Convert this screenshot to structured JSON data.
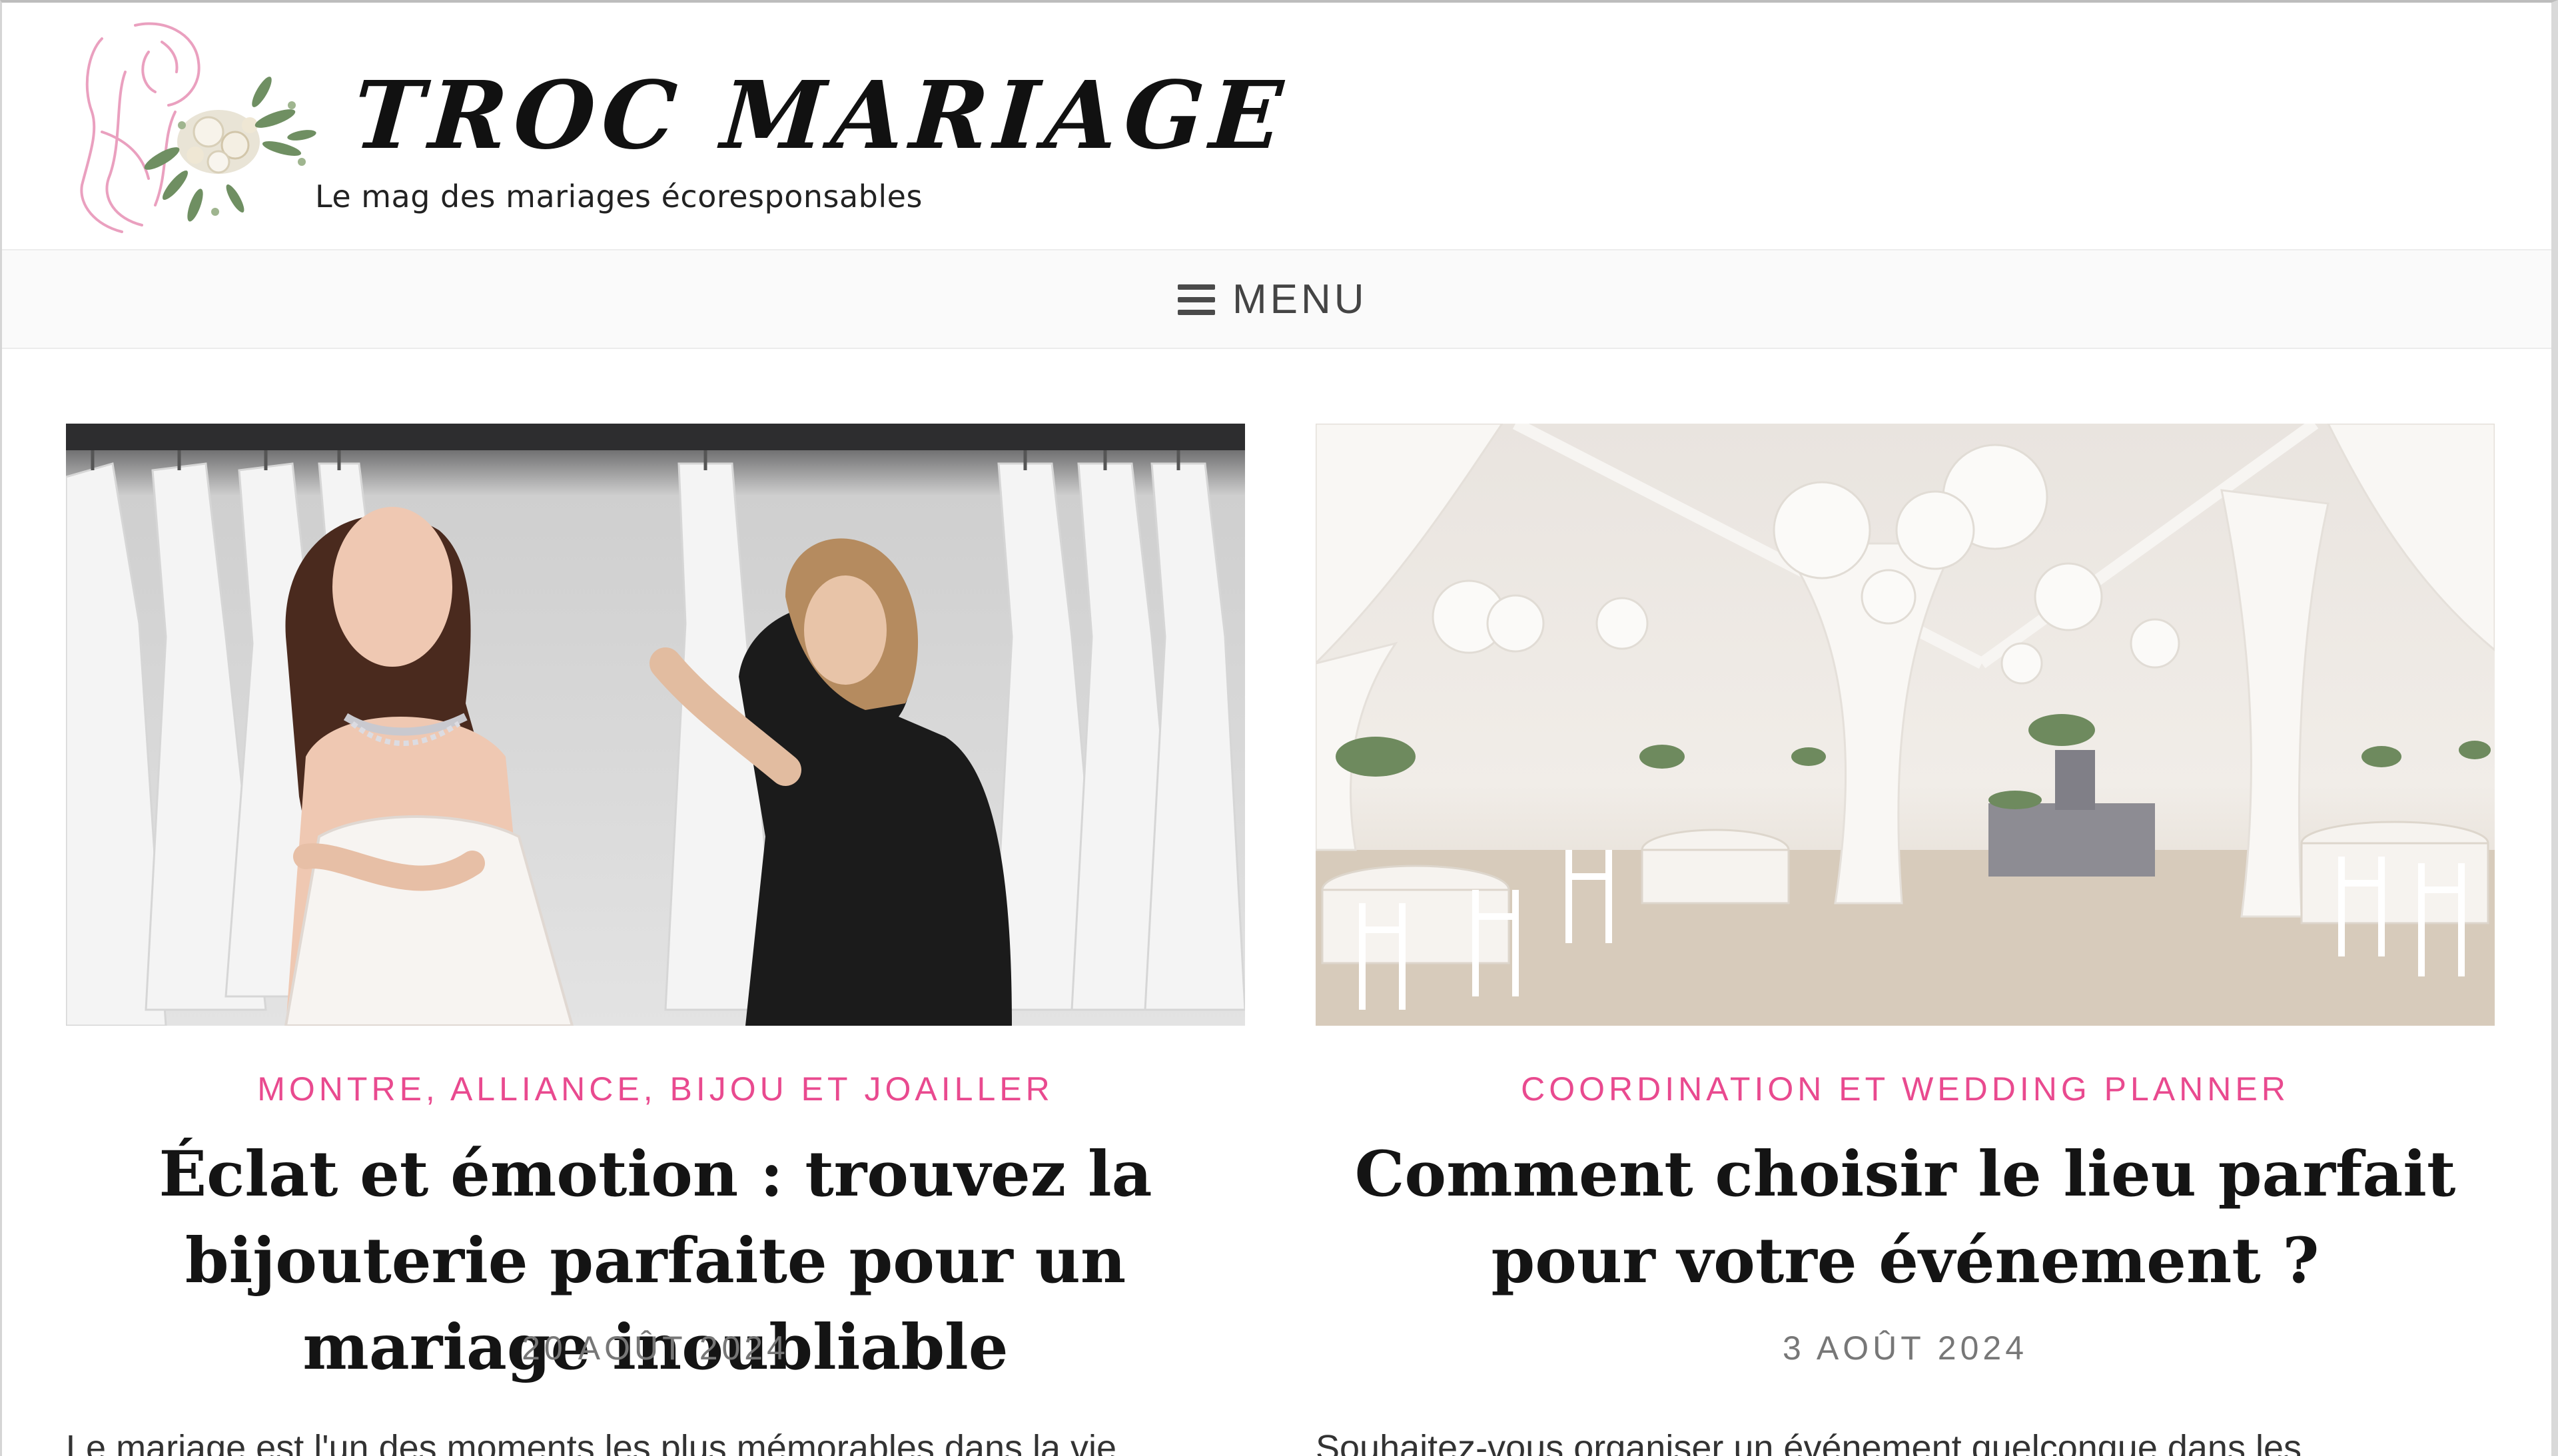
{
  "header": {
    "site_title": "TROC MARIAGE",
    "tagline": "Le mag des mariages écoresponsables"
  },
  "nav": {
    "menu_label": "MENU"
  },
  "posts": [
    {
      "category": "MONTRE, ALLIANCE, BIJOU ET JOAILLER",
      "title": "Éclat et émotion : trouvez la bijouterie parfaite pour un mariage inoubliable",
      "date": "20 AOÛT 2024",
      "excerpt": "Le mariage est l'un des moments les plus mémorables dans la vie"
    },
    {
      "category": "COORDINATION ET WEDDING PLANNER",
      "title": "Comment choisir le lieu parfait pour votre événement ?",
      "date": "3 AOÛT 2024",
      "excerpt": "Souhaitez-vous organiser un événement quelconque dans les"
    }
  ],
  "colors": {
    "accent_pink": "#e94a8f",
    "title_text": "#141414",
    "meta_grey": "#777777"
  },
  "icons": {
    "menu": "hamburger-icon"
  }
}
